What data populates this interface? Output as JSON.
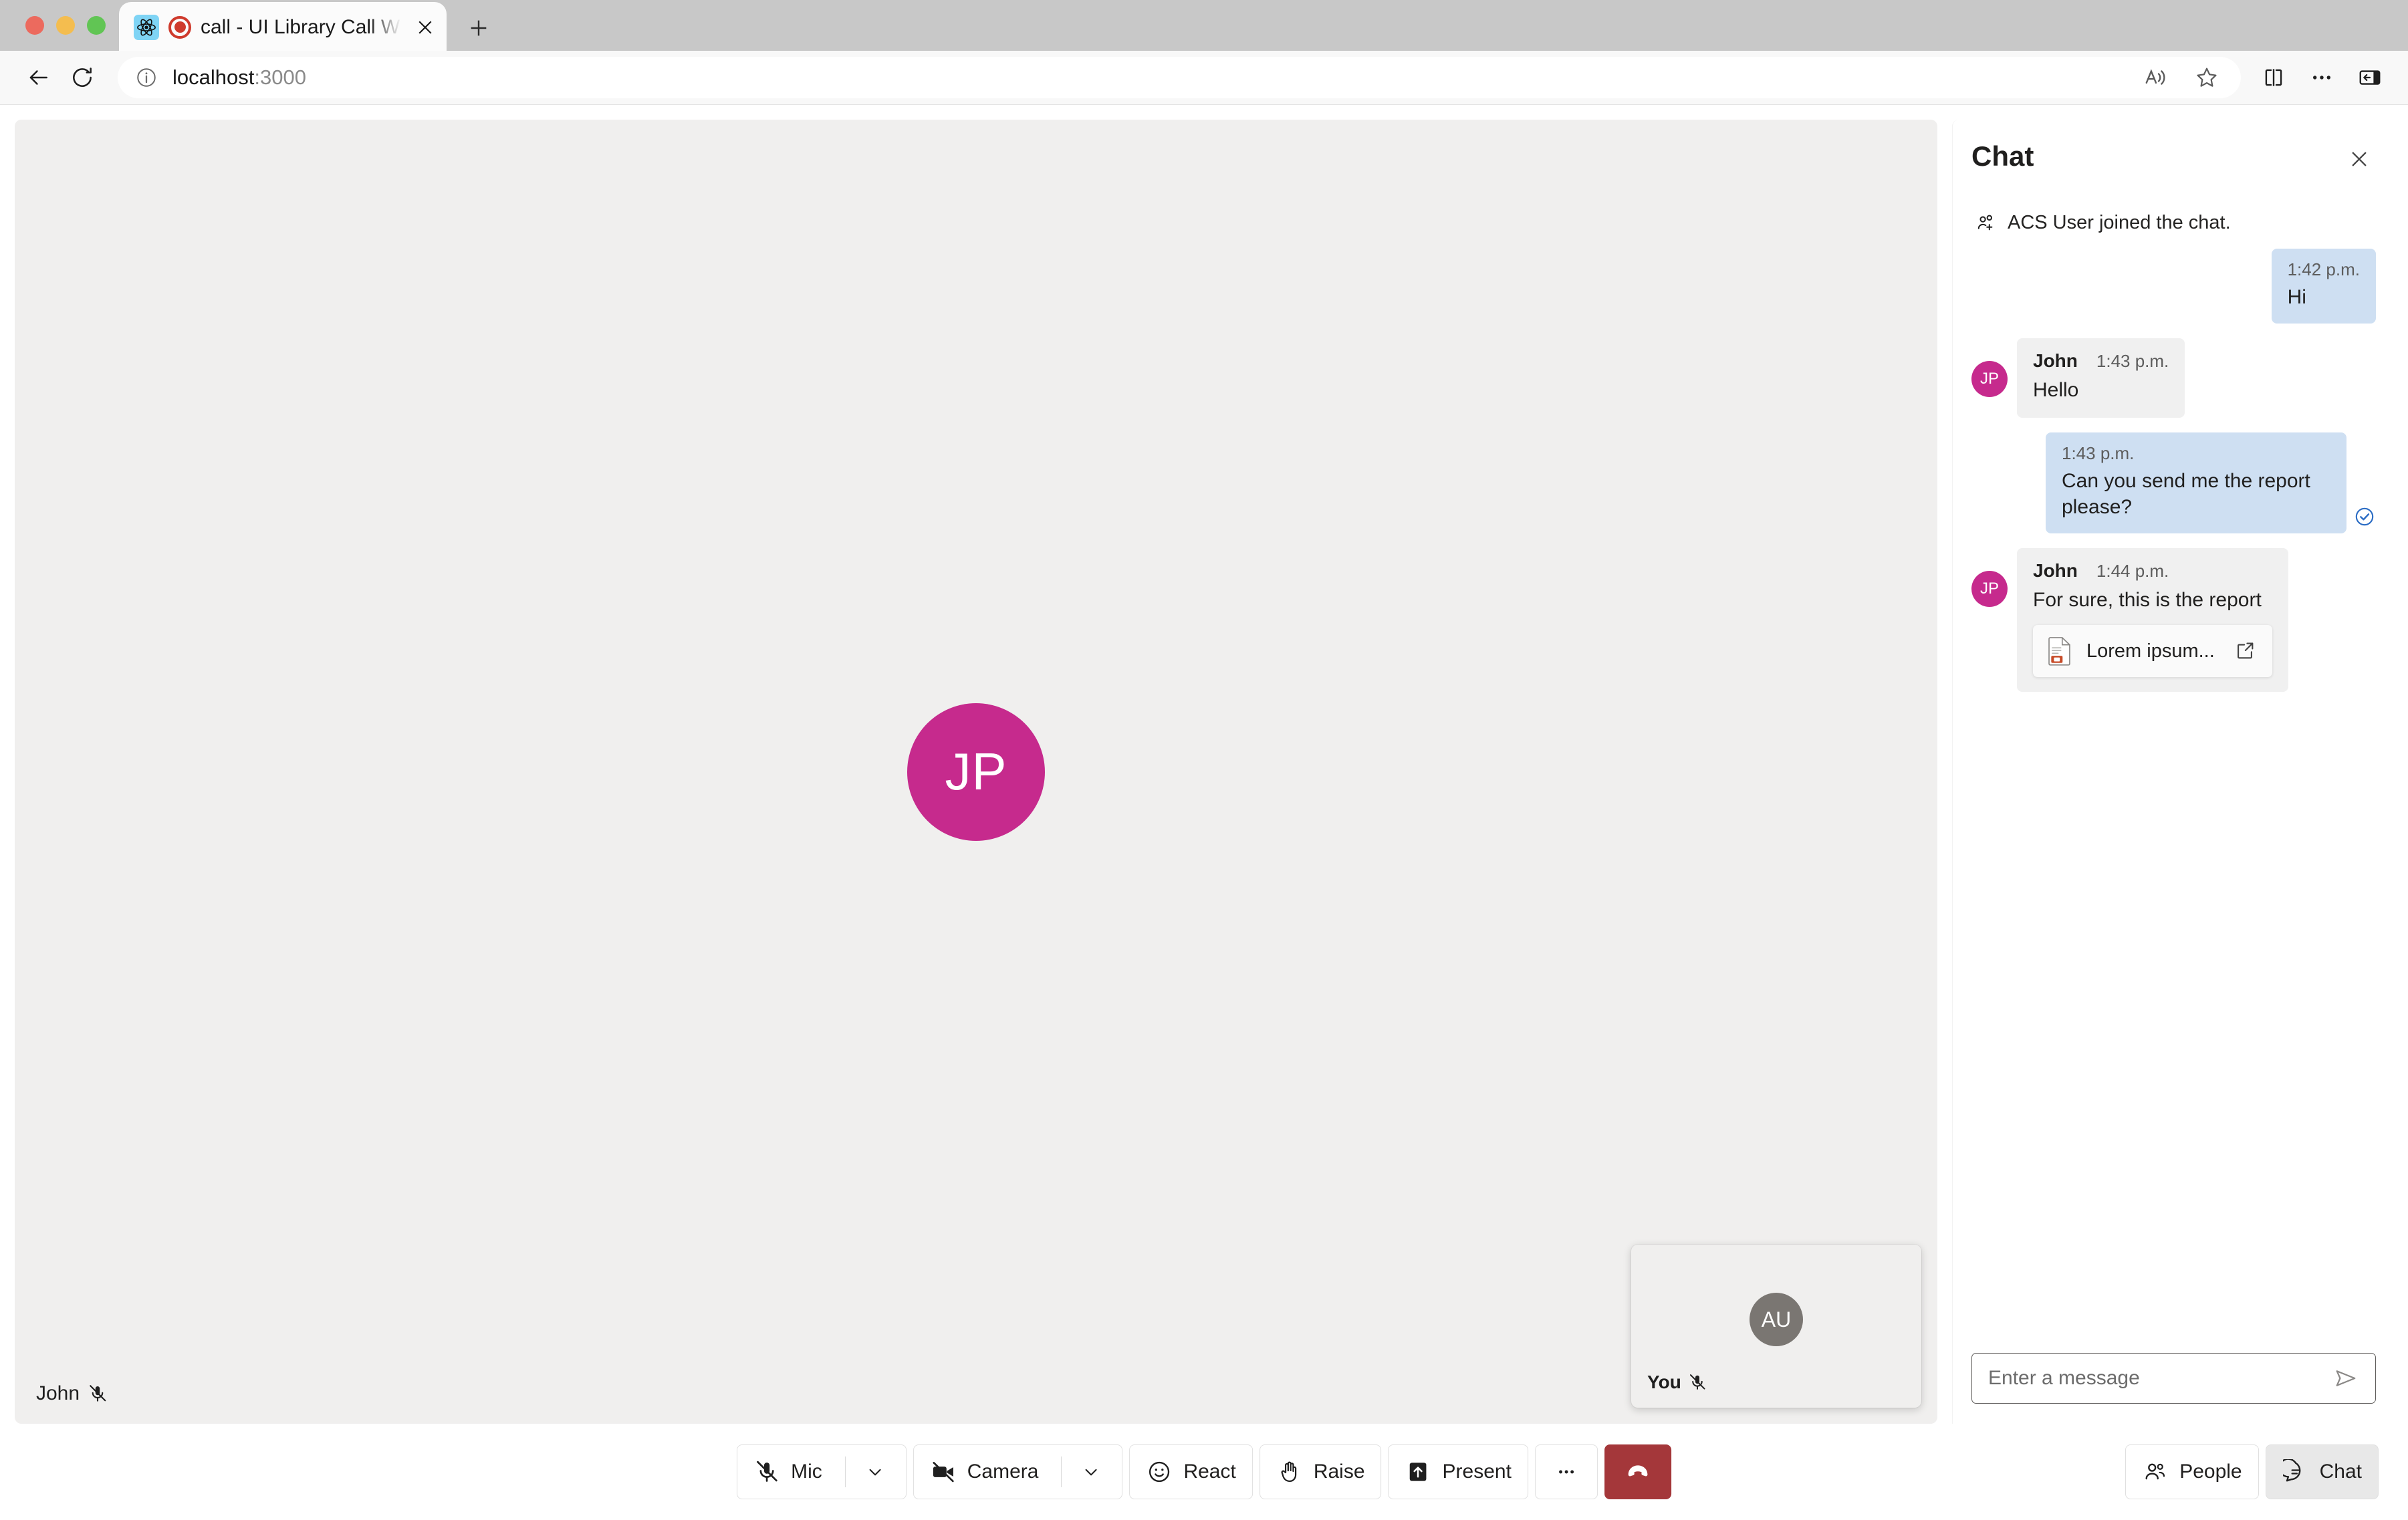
{
  "browser": {
    "tab": {
      "title": "call - UI Library Call With C",
      "favicon_name": "react-logo-icon",
      "recording_indicator": "recording-icon",
      "close_label": "×"
    },
    "new_tab_label": "+",
    "nav": {
      "back": "back-arrow-icon",
      "reload": "reload-icon"
    },
    "address": {
      "host": "localhost",
      "port": ":3000",
      "full": "localhost:3000",
      "info_icon": "site-info-icon"
    },
    "toolbar_right": [
      {
        "name": "read-aloud-icon",
        "label": "Read aloud"
      },
      {
        "name": "favorite-star-icon",
        "label": "Add to favorites"
      },
      {
        "name": "split-screen-icon",
        "label": "Split screen"
      },
      {
        "name": "more-options-icon",
        "label": "Settings and more"
      },
      {
        "name": "collections-icon",
        "label": "Browser essentials"
      }
    ]
  },
  "call": {
    "remote_participant": {
      "initials": "JP",
      "display_name": "John",
      "muted": true,
      "mic_icon": "mic-off-icon",
      "avatar_color": "#c62a8d"
    },
    "local_participant": {
      "initials": "AU",
      "display_name": "You",
      "muted": true,
      "mic_icon": "mic-off-icon",
      "avatar_color": "#7a7672"
    }
  },
  "controls": {
    "buttons": [
      {
        "id": "mic",
        "label": "Mic",
        "icon": "mic-off-icon",
        "has_caret": true,
        "caret_icon": "chevron-down-icon"
      },
      {
        "id": "camera",
        "label": "Camera",
        "icon": "camera-off-icon",
        "has_caret": true,
        "caret_icon": "chevron-down-icon"
      },
      {
        "id": "react",
        "label": "React",
        "icon": "emoji-smile-icon",
        "has_caret": false
      },
      {
        "id": "raise",
        "label": "Raise",
        "icon": "raise-hand-icon",
        "has_caret": false
      },
      {
        "id": "present",
        "label": "Present",
        "icon": "share-screen-icon",
        "has_caret": false
      }
    ],
    "more_label": "•••",
    "more_icon": "more-horizontal-icon",
    "end_call_icon": "end-call-icon",
    "end_call_label": "End call",
    "end_call_color": "#a4373a",
    "right_buttons": [
      {
        "id": "people",
        "label": "People",
        "icon": "people-icon",
        "active": false
      },
      {
        "id": "chat",
        "label": "Chat",
        "icon": "chat-bubble-icon",
        "active": true
      }
    ]
  },
  "chat": {
    "title": "Chat",
    "close_icon": "close-icon",
    "close_label": "×",
    "system_message": {
      "icon": "person-add-icon",
      "text": "ACS User joined the chat."
    },
    "messages": [
      {
        "id": "m1",
        "side": "local",
        "time": "1:42 p.m.",
        "text": "Hi",
        "read_receipt": false
      },
      {
        "id": "m2",
        "side": "remote",
        "sender": "John",
        "initials": "JP",
        "time": "1:43 p.m.",
        "text": "Hello"
      },
      {
        "id": "m3",
        "side": "local",
        "time": "1:43 p.m.",
        "text": "Can you send me the report please?",
        "read_receipt": true,
        "read_receipt_icon": "checkmark-circle-icon"
      },
      {
        "id": "m4",
        "side": "remote",
        "sender": "John",
        "initials": "JP",
        "time": "1:44 p.m.",
        "text": "For sure, this is the report",
        "attachment": {
          "name": "Lorem ipsum...",
          "file_icon": "powerpoint-file-icon",
          "open_icon": "open-external-icon"
        }
      }
    ],
    "input": {
      "placeholder": "Enter a message",
      "value": "",
      "send_icon": "send-icon"
    }
  },
  "colors": {
    "accent_magenta": "#c62a8d",
    "local_bubble": "#cedff2",
    "remote_bubble": "#f0f0f0",
    "stage_bg": "#f0efee",
    "end_call": "#a4373a",
    "read_receipt_blue": "#2b6cc4"
  }
}
